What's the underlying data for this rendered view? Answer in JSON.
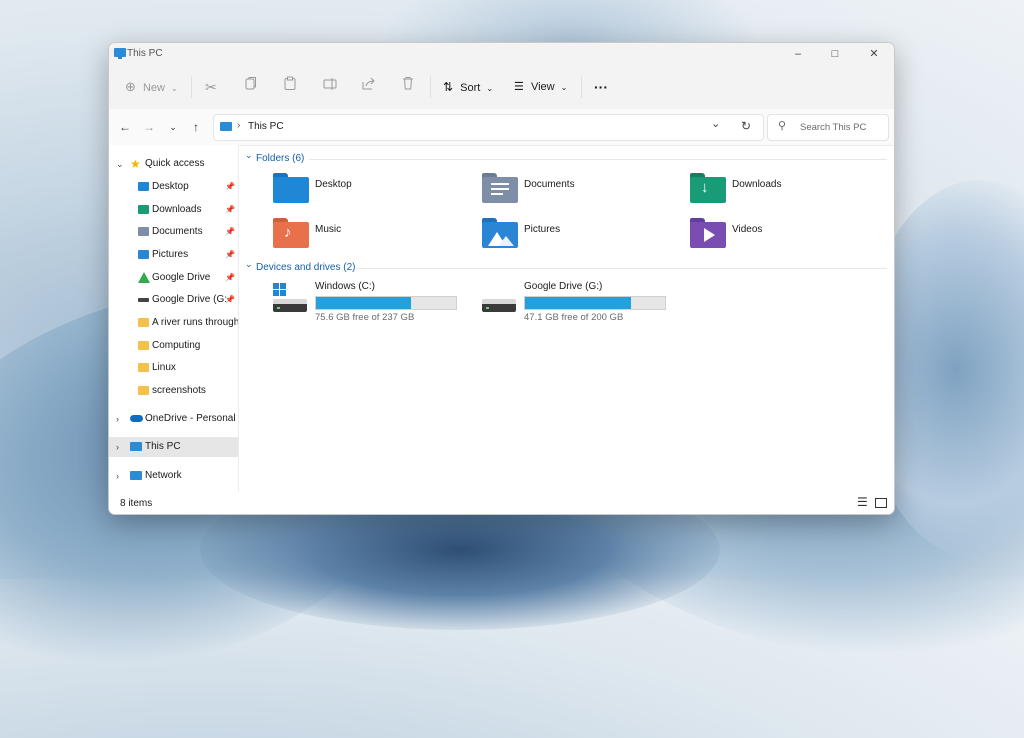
{
  "window": {
    "title": "This PC",
    "controls": {
      "minimize_icon": "minimize-icon",
      "maximize_icon": "maximize-icon",
      "close_icon": "close-icon"
    }
  },
  "toolbar": {
    "new_label": "New",
    "sort_label": "Sort",
    "view_label": "View",
    "items": [
      "new-icon",
      "cut-icon",
      "copy-icon",
      "paste-icon",
      "rename-icon",
      "share-icon",
      "delete-icon",
      "sort-icon",
      "view-icon",
      "more-icon"
    ]
  },
  "address": {
    "location": "This PC",
    "search_placeholder": "Search This PC"
  },
  "sidebar": {
    "quick_access": "Quick access",
    "items": [
      {
        "label": "Desktop",
        "icon": "desktop-folder-icon",
        "pinned": true
      },
      {
        "label": "Downloads",
        "icon": "downloads-folder-icon",
        "pinned": true
      },
      {
        "label": "Documents",
        "icon": "documents-folder-icon",
        "pinned": true
      },
      {
        "label": "Pictures",
        "icon": "pictures-folder-icon",
        "pinned": true
      },
      {
        "label": "Google Drive",
        "icon": "google-drive-icon",
        "pinned": true
      },
      {
        "label": "Google Drive (G:",
        "icon": "drive-icon",
        "pinned": true
      },
      {
        "label": "A river runs through",
        "icon": "folder-icon",
        "pinned": false
      },
      {
        "label": "Computing",
        "icon": "folder-icon",
        "pinned": false
      },
      {
        "label": "Linux",
        "icon": "folder-icon",
        "pinned": false
      },
      {
        "label": "screenshots",
        "icon": "folder-icon",
        "pinned": false
      }
    ],
    "onedrive": "OneDrive - Personal",
    "this_pc": "This PC",
    "network": "Network"
  },
  "content": {
    "folders_header": "Folders (6)",
    "folders": [
      {
        "name": "Desktop",
        "color": "#1e88d6"
      },
      {
        "name": "Documents",
        "color": "#7d8ea6"
      },
      {
        "name": "Downloads",
        "color": "#1a9b78"
      },
      {
        "name": "Music",
        "color": "#e8714b"
      },
      {
        "name": "Pictures",
        "color": "#2a86d4"
      },
      {
        "name": "Videos",
        "color": "#7a4db3"
      }
    ],
    "drives_header": "Devices and drives (2)",
    "drives": [
      {
        "name": "Windows  (C:)",
        "free": "75.6 GB free of 237 GB",
        "used_fraction": 0.68
      },
      {
        "name": "Google Drive (G:)",
        "free": "47.1 GB free of 200 GB",
        "used_fraction": 0.76
      }
    ]
  },
  "status": {
    "items_count": "8 items",
    "details_view_icon": "details-view-icon",
    "tiles_view_icon": "tiles-view-icon"
  },
  "colors": {
    "accent": "#26a0da",
    "section_header": "#1560a8"
  }
}
